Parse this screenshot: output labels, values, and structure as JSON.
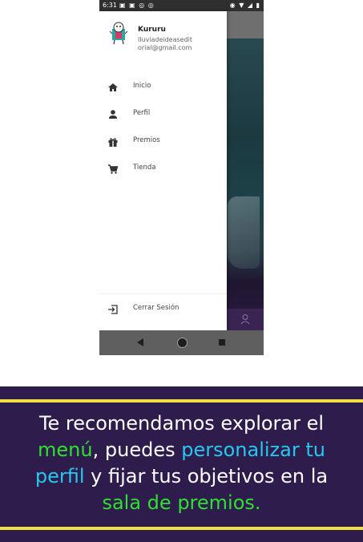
{
  "status_bar": {
    "time": "6:31",
    "left_icons": "▣ ▣ ◎ ◎",
    "right_icons": "◉ ▼ ◢ ▮"
  },
  "drawer": {
    "user_name": "Kururu",
    "user_email": "lluviadeideaseditorial@gmail.com",
    "menu_items": [
      {
        "label": "Inicio",
        "icon": "home-icon"
      },
      {
        "label": "Perfil",
        "icon": "person-icon"
      },
      {
        "label": "Premios",
        "icon": "gift-icon"
      },
      {
        "label": "Tienda",
        "icon": "cart-icon"
      }
    ],
    "logout_label": "Cerrar Sesión",
    "logout_icon": "logout-icon"
  },
  "nav_bar": {
    "back_icon": "back-icon",
    "home_icon": "home-circle-icon",
    "recent_icon": "recent-apps-icon"
  },
  "caption": {
    "p1": "Te recomendamos explorar el ",
    "h1": "menú",
    "p2": ", puedes ",
    "h2": "personalizar tu perfil",
    "p3": " y fijar tus objetivos en la ",
    "h3": "sala de premios."
  },
  "colors": {
    "caption_bg": "#2d1c4c",
    "caption_line": "#f2e040",
    "highlight_green": "#2fe02f",
    "highlight_cyan": "#27c8f0"
  }
}
